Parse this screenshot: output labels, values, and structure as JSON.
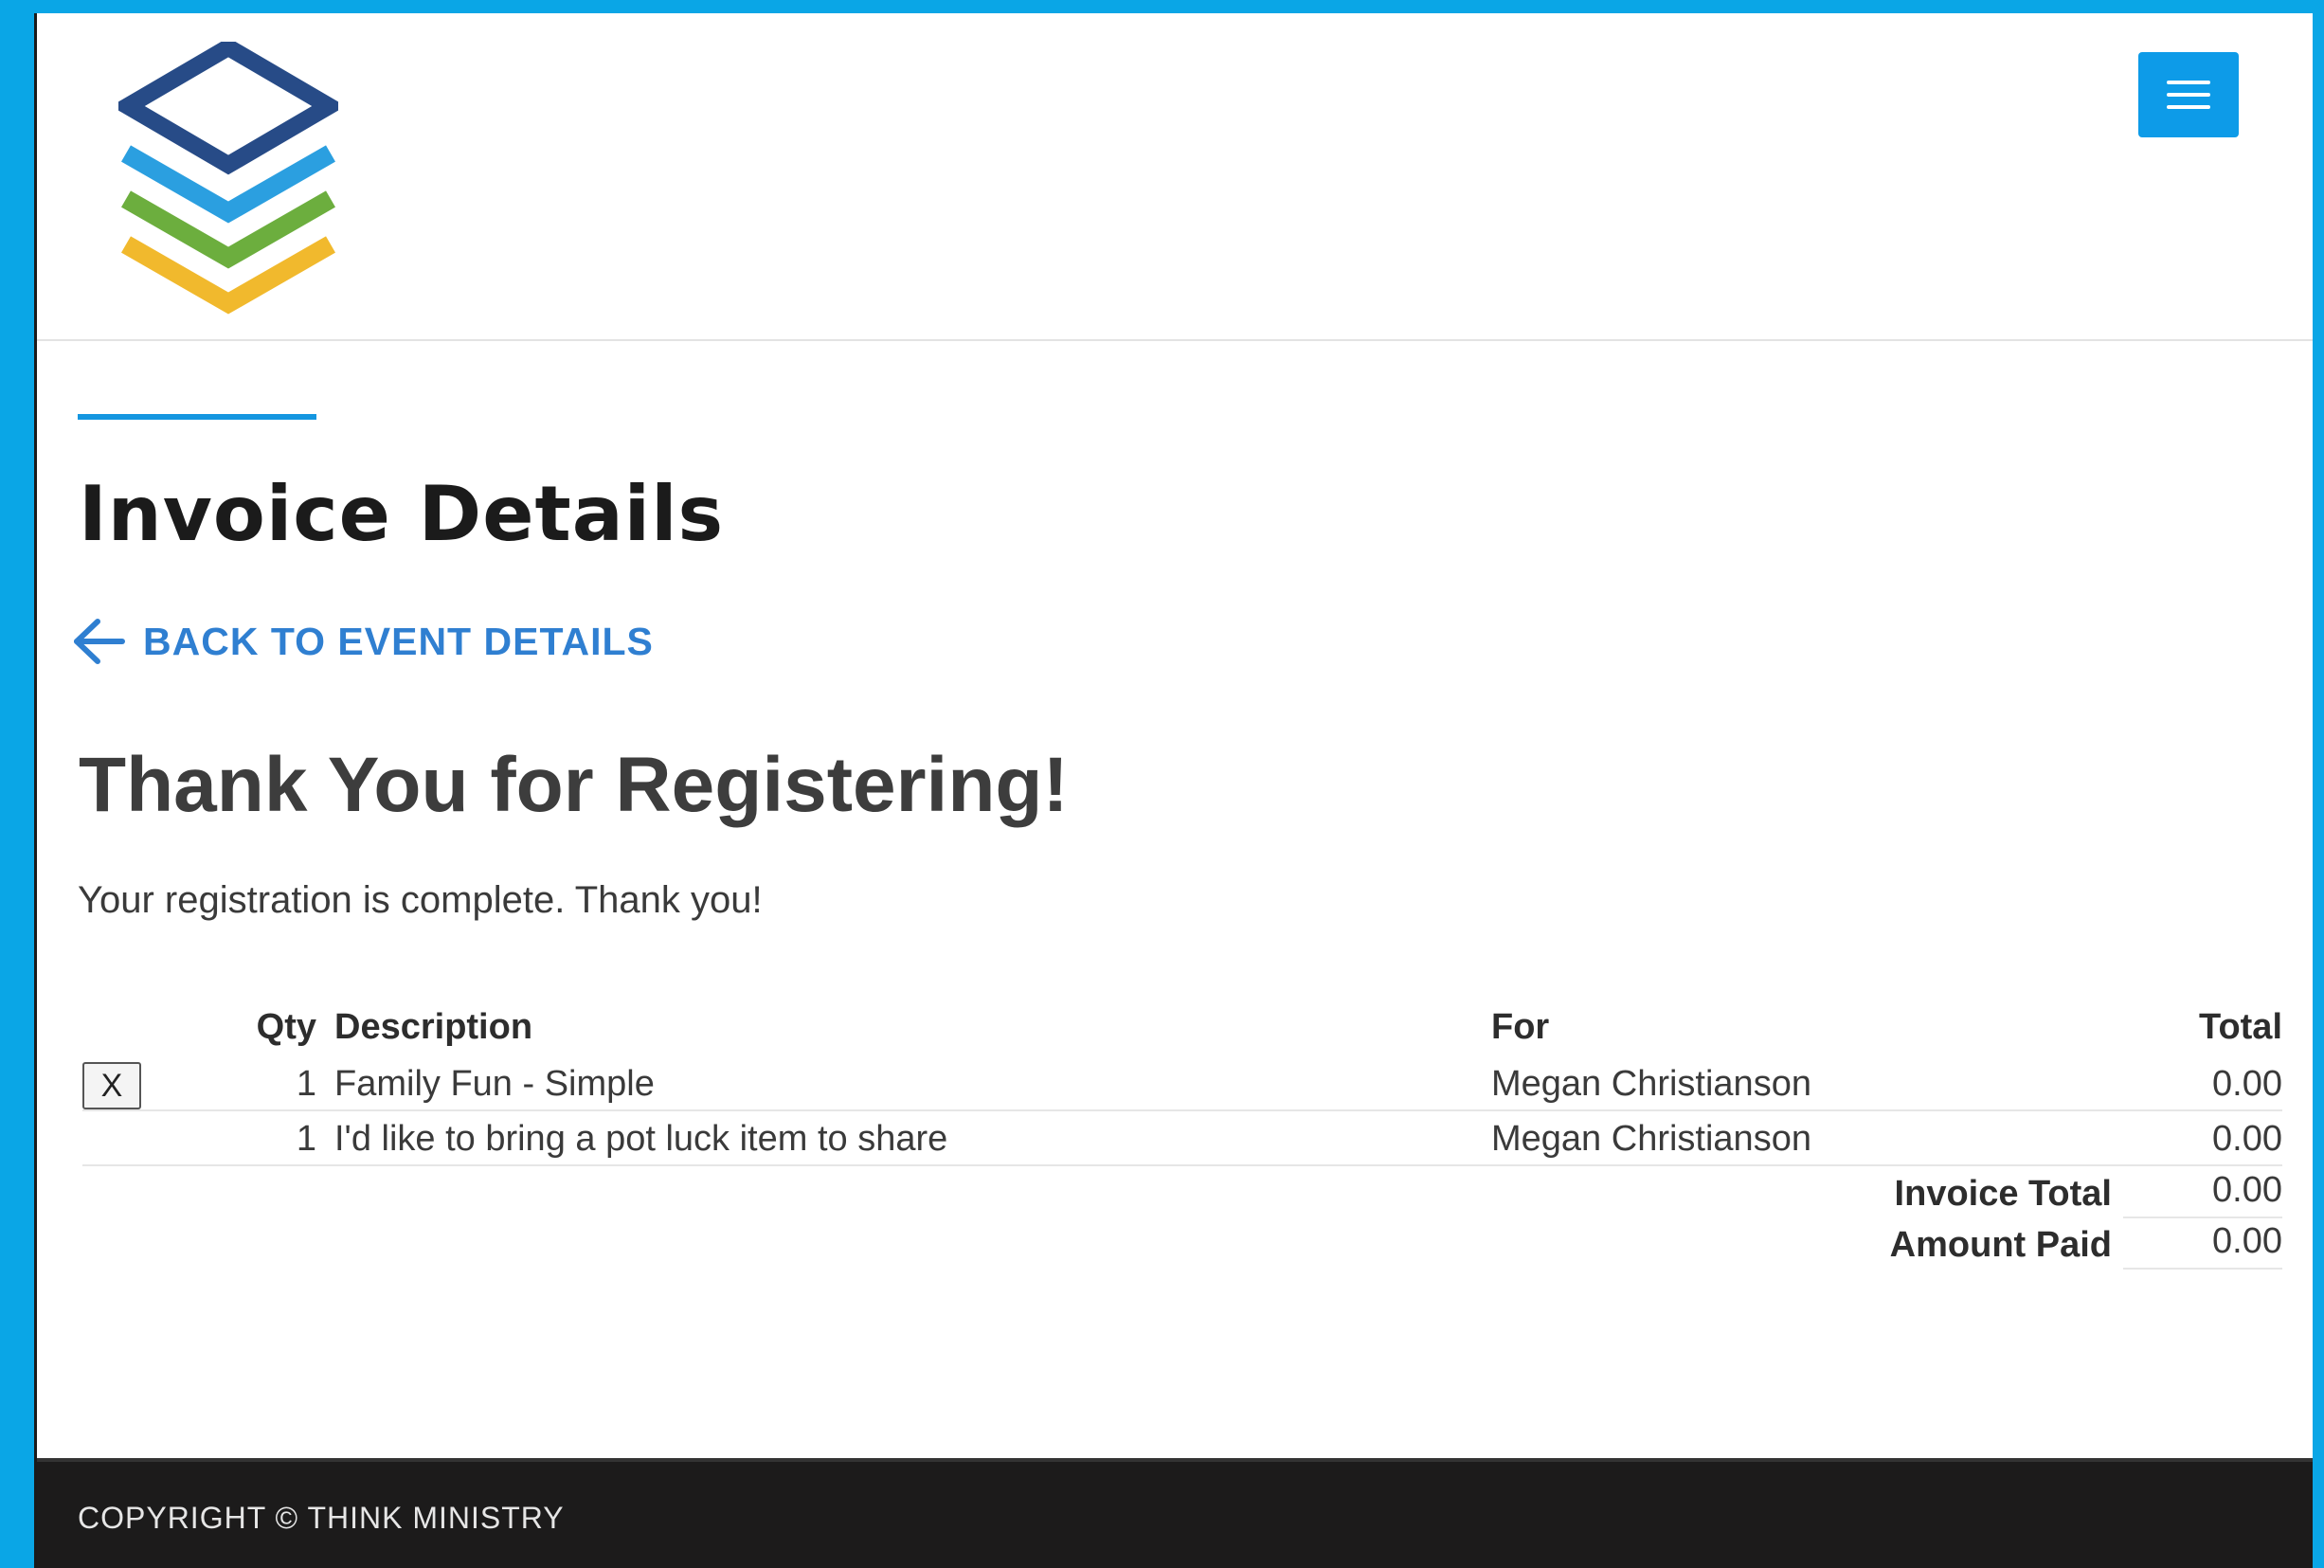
{
  "header": {
    "logo_icon": "stacked-layers-logo-icon",
    "menu_icon": "hamburger-icon",
    "colors": {
      "logo_top": "#274b87",
      "logo_blue": "#2b9fe0",
      "logo_green": "#6cae3e",
      "logo_yellow": "#f1b92d",
      "menu_button": "#0d9be8"
    }
  },
  "main": {
    "title": "Invoice Details",
    "back_link": {
      "label": "BACK TO EVENT DETAILS",
      "icon": "arrow-left-icon"
    },
    "thanks_title": "Thank You for Registering!",
    "thanks_text": "Your registration is complete. Thank you!",
    "accent_color": "#1496e0"
  },
  "invoice": {
    "columns": {
      "qty": "Qty",
      "description": "Description",
      "for": "For",
      "total": "Total"
    },
    "remove_label": "X",
    "items": [
      {
        "qty": "1",
        "description": "Family Fun - Simple",
        "for": "Megan Christianson",
        "total": "0.00",
        "removable": true
      },
      {
        "qty": "1",
        "description": "I'd like to bring a pot luck item to share",
        "for": "Megan Christianson",
        "total": "0.00",
        "removable": false
      }
    ],
    "summary": {
      "invoice_total_label": "Invoice Total",
      "invoice_total_value": "0.00",
      "amount_paid_label": "Amount Paid",
      "amount_paid_value": "0.00"
    }
  },
  "footer": {
    "copyright": "COPYRIGHT © THINK MINISTRY"
  }
}
